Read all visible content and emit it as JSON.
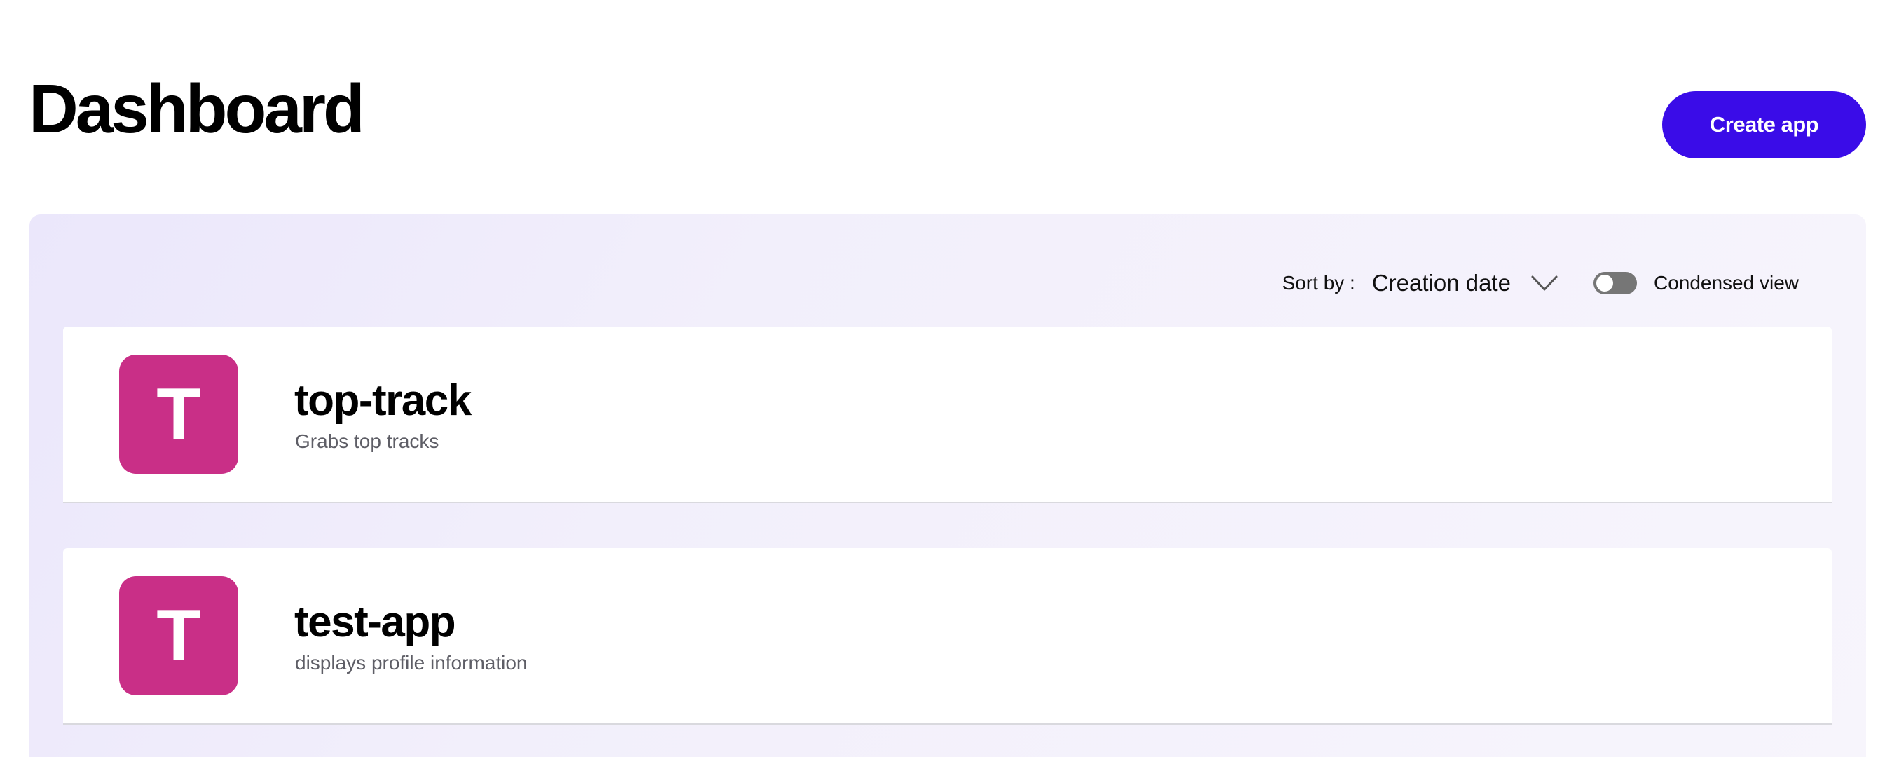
{
  "header": {
    "title": "Dashboard",
    "create_label": "Create app"
  },
  "toolbar": {
    "sort_label": "Sort by :",
    "sort_value": "Creation date",
    "toggle_label": "Condensed view",
    "toggle_on": false
  },
  "apps": [
    {
      "initial": "T",
      "name": "top-track",
      "description": "Grabs top tracks"
    },
    {
      "initial": "T",
      "name": "test-app",
      "description": "displays profile information"
    }
  ],
  "icons": {
    "sort_chevron": "chevron-down-icon"
  },
  "colors": {
    "accent": "#3a0ce8",
    "avatar": "#c92f87",
    "toggle_off": "#767676"
  }
}
